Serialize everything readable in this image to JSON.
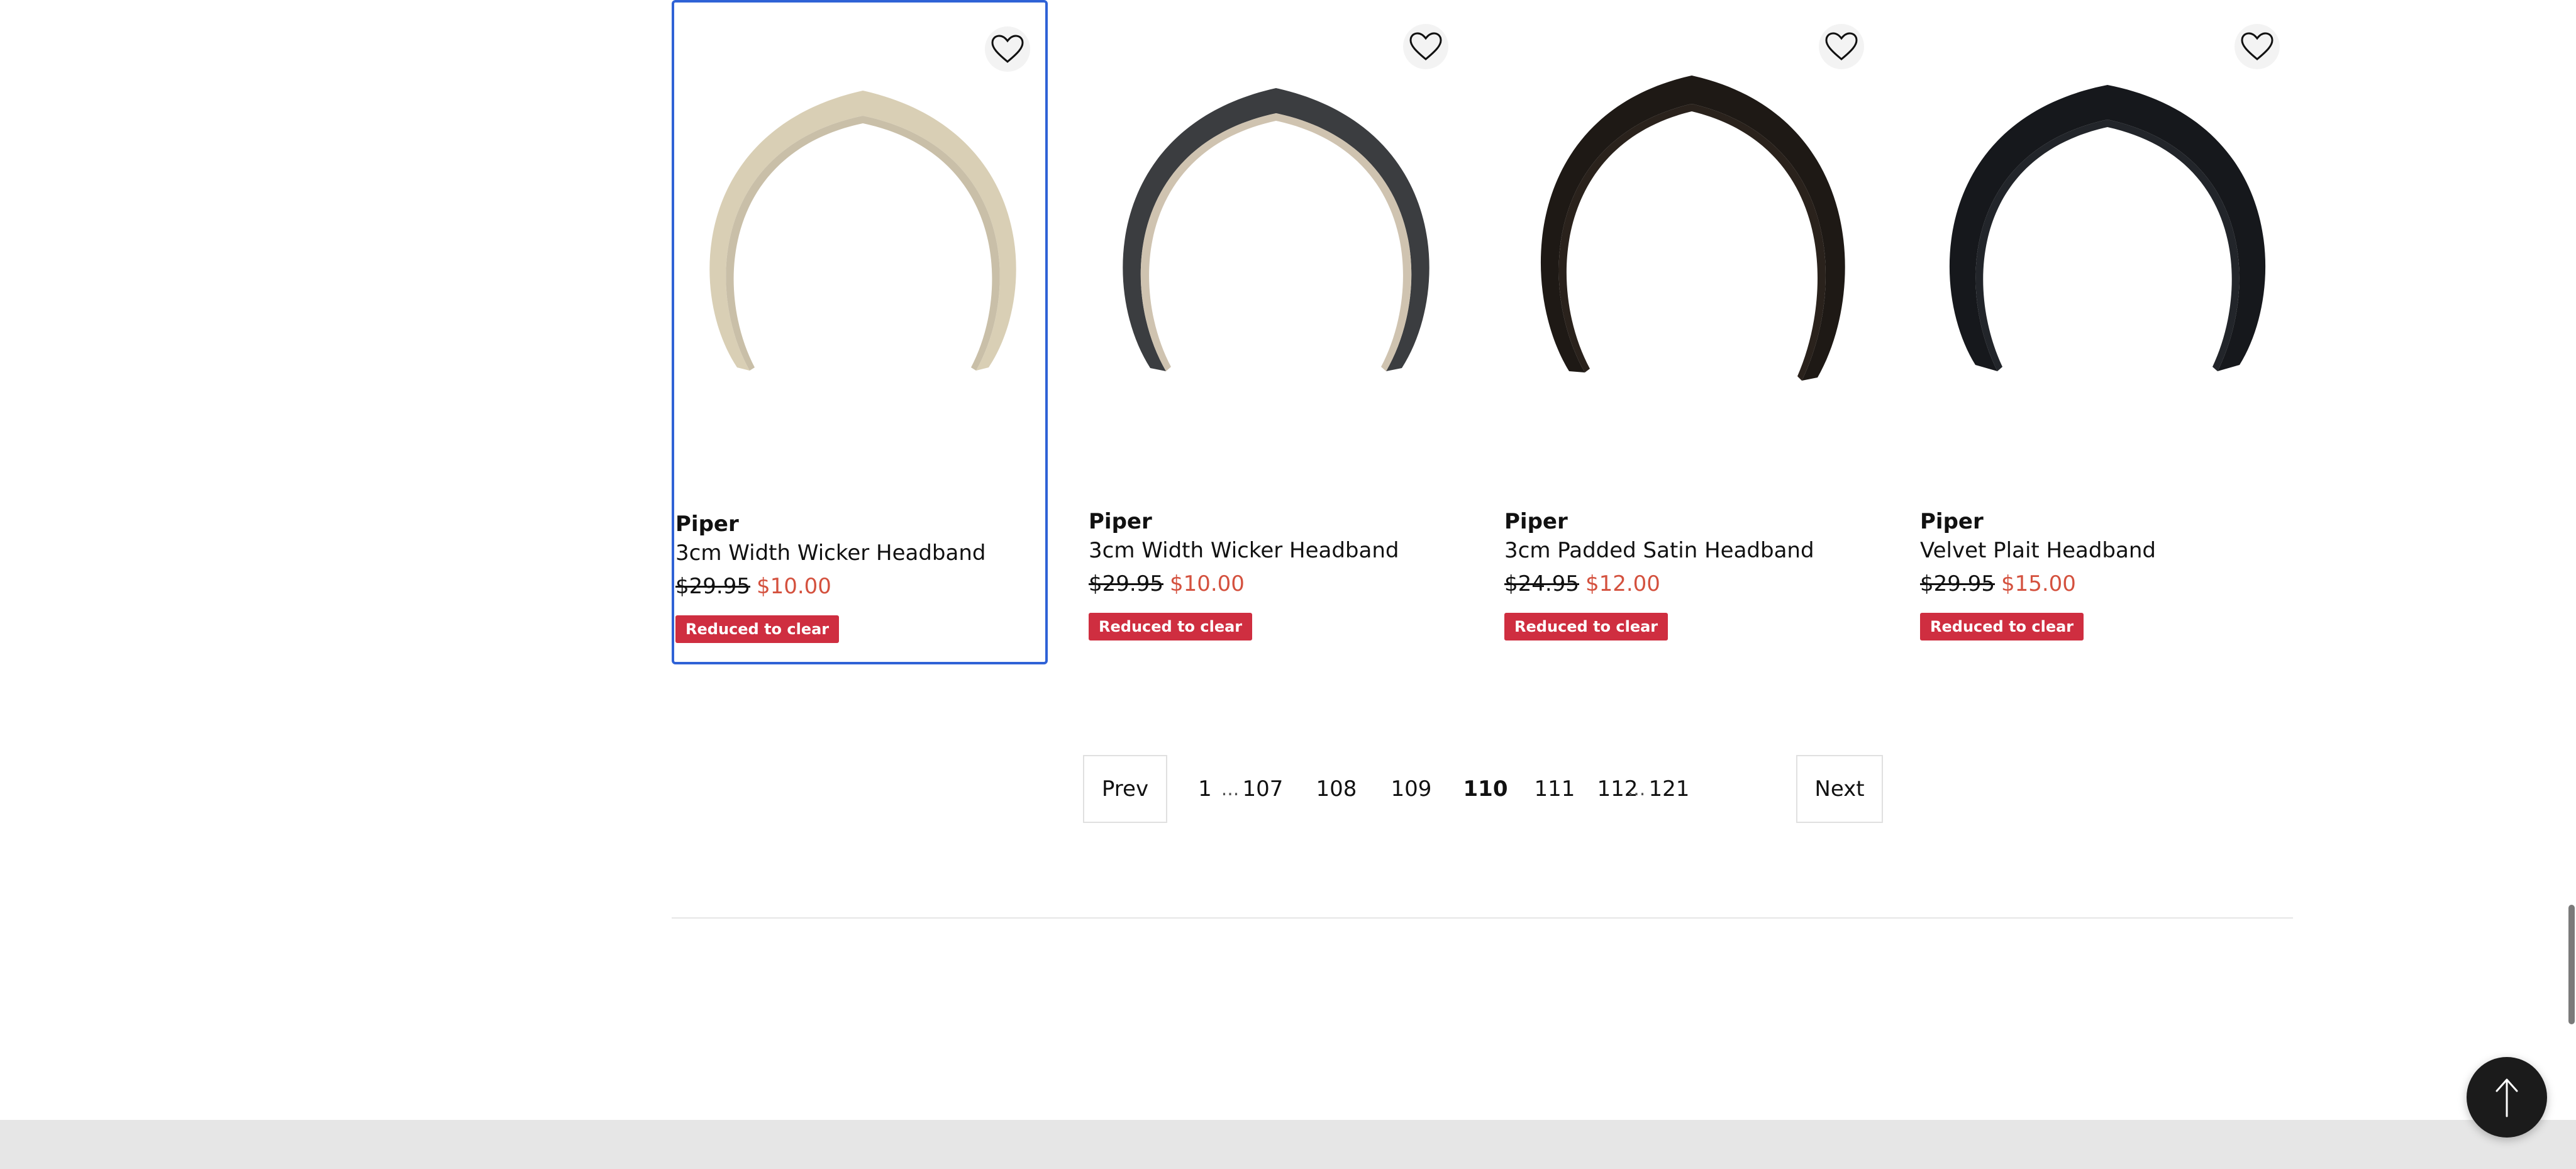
{
  "products": [
    {
      "brand": "Piper",
      "name": "3cm Width Wicker Headband",
      "was_price": "$29.95",
      "now_price": "$10.00",
      "badge": "Reduced to clear",
      "headband_color": "#d9cfb5",
      "headband_inner": "#c9bfa8"
    },
    {
      "brand": "Piper",
      "name": "3cm Width Wicker Headband",
      "was_price": "$29.95",
      "now_price": "$10.00",
      "badge": "Reduced to clear",
      "headband_color": "#3b3d40",
      "headband_inner": "#cfc3b0"
    },
    {
      "brand": "Piper",
      "name": "3cm Padded Satin Headband",
      "was_price": "$24.95",
      "now_price": "$12.00",
      "badge": "Reduced to clear",
      "headband_color": "#1e1915",
      "headband_inner": "#2a221c"
    },
    {
      "brand": "Piper",
      "name": "Velvet Plait Headband",
      "was_price": "$29.95",
      "now_price": "$15.00",
      "badge": "Reduced to clear",
      "headband_color": "#16181c",
      "headband_inner": "#22252a"
    }
  ],
  "pagination": {
    "prev_label": "Prev",
    "next_label": "Next",
    "ellipsis": "...",
    "pages": [
      "1",
      "107",
      "108",
      "109",
      "110",
      "111",
      "112",
      "121"
    ],
    "current": "110"
  },
  "icons": {
    "wishlist": "heart-outline-icon",
    "back_to_top": "arrow-up-icon"
  },
  "colors": {
    "selected_outline": "#2f62d6",
    "sale_price": "#d4513e",
    "badge_bg": "#cf2e40"
  }
}
